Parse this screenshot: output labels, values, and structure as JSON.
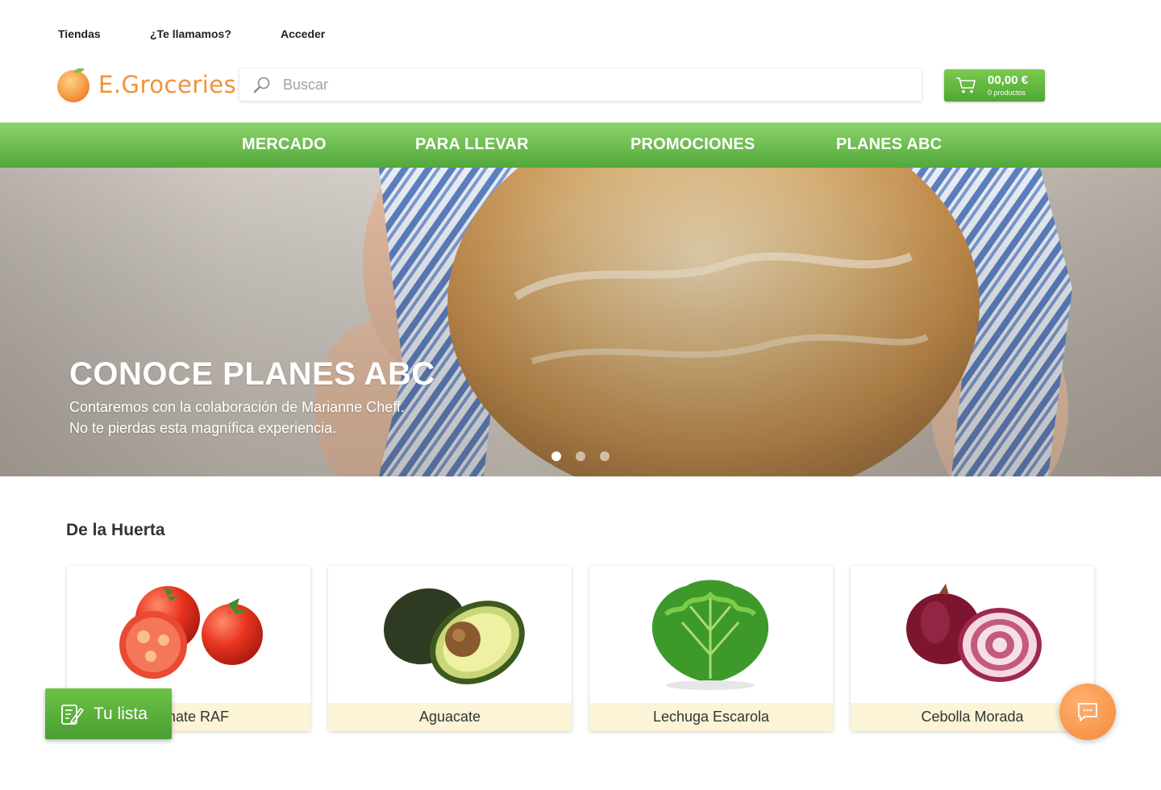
{
  "top_links": [
    "Tiendas",
    "¿Te llamamos?",
    "Acceder"
  ],
  "brand": {
    "name": "E.Groceries",
    "color": "#f0923a"
  },
  "search": {
    "placeholder": "Buscar"
  },
  "cart": {
    "amount": "00,00 €",
    "count_label": "0 productos"
  },
  "nav": {
    "items": [
      "MERCADO",
      "PARA LLEVAR",
      "PROMOCIONES",
      "PLANES ABC"
    ],
    "color": "#5cb340"
  },
  "hero": {
    "title": "CONOCE PLANES ABC",
    "subtitle_lines": [
      "Contaremos con la colaboración de Marianne Cheff.",
      "No te pierdas esta magnífica experiencia."
    ],
    "slides": 3,
    "active_slide": 1
  },
  "section": {
    "title": "De la Huerta",
    "products": [
      {
        "name": "Tomate RAF",
        "icon": "tomato"
      },
      {
        "name": "Aguacate",
        "icon": "avocado"
      },
      {
        "name": "Lechuga Escarola",
        "icon": "lettuce"
      },
      {
        "name": "Cebolla Morada",
        "icon": "red-onion"
      }
    ]
  },
  "floating": {
    "list_label": "Tu lista",
    "list_icon": "list-edit-icon",
    "chat_icon": "chat-icon"
  }
}
